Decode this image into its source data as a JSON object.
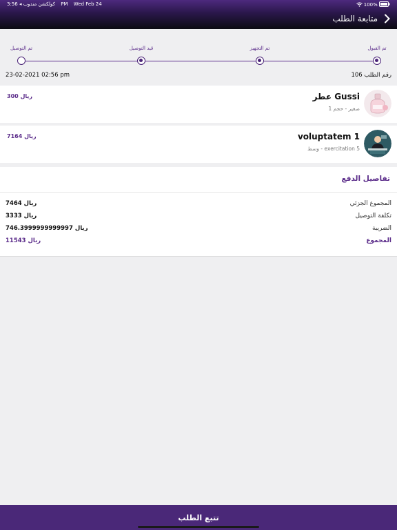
{
  "status_bar": {
    "carrier": "كولكشن مندوب ◂",
    "time": "3:56 PM",
    "date": "Wed Feb 24",
    "battery": "100%"
  },
  "nav": {
    "title": "متابعة الطلب",
    "back_icon": "chevron-right-icon"
  },
  "tracking": {
    "steps": [
      {
        "label": "تم القبول",
        "done": true
      },
      {
        "label": "تم التجهيز",
        "done": true
      },
      {
        "label": "قيد التوصيل",
        "done": true
      },
      {
        "label": "تم التوصيل",
        "done": false
      }
    ]
  },
  "order": {
    "number": "رقم الطلب 106",
    "date": "23-02-2021 02:56 pm"
  },
  "items": [
    {
      "name": "عطر Gussi",
      "sub": "صغير - حجم 1",
      "price": "300 ريال",
      "thumb": "perfume-bottle"
    },
    {
      "name": "voluptatem 1",
      "sub": "وسط - exercitation 5",
      "price": "7164 ريال",
      "thumb": "person-at-desk"
    }
  ],
  "payment": {
    "title": "تفاصيل الدفع",
    "rows": [
      {
        "label": "المجموع الجزئي",
        "value": "7464 ريال"
      },
      {
        "label": "تكلفة التوصيل",
        "value": "3333 ريال"
      },
      {
        "label": "الضريبة",
        "value": "746.3999999999997 ريال"
      },
      {
        "label": "المجموع",
        "value": "11543 ريال"
      }
    ]
  },
  "bottom_button": {
    "label": "تتبع الطلب"
  },
  "colors": {
    "accent": "#5b2c8a",
    "bottom_bar": "#4a2878"
  }
}
